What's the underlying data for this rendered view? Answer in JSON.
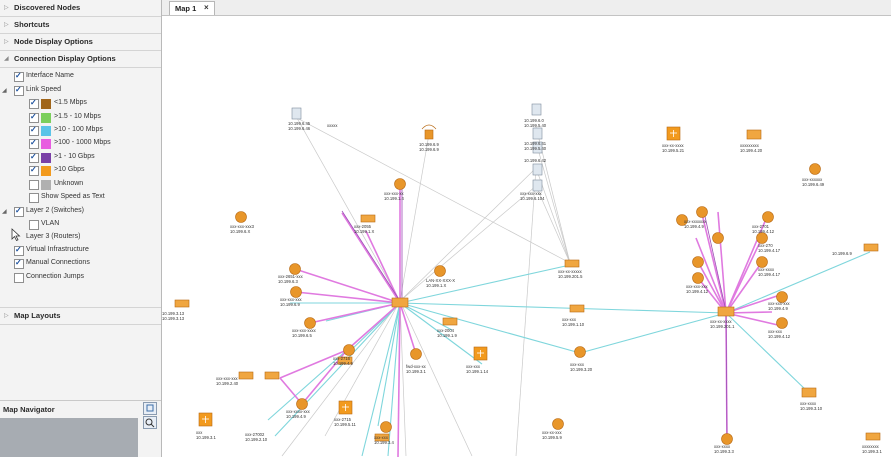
{
  "sidebar": {
    "sections": {
      "discovered": "Discovered Nodes",
      "shortcuts": "Shortcuts",
      "node_display": "Node Display Options",
      "connection_display": "Connection Display Options",
      "map_layouts": "Map Layouts"
    },
    "options": {
      "interface_name": "Interface Name",
      "link_speed": "Link Speed",
      "show_speed_text": "Show Speed as Text",
      "layer2": "Layer 2 (Switches)",
      "vlan": "VLAN",
      "layer3": "Layer 3 (Routers)",
      "virtual": "Virtual Infrastructure",
      "manual": "Manual Connections",
      "jumps": "Connection Jumps"
    },
    "speeds": [
      {
        "label": "<1.5 Mbps",
        "color": "#a0651a"
      },
      {
        "label": ">1.5 - 10 Mbps",
        "color": "#7bcf5c"
      },
      {
        "label": ">10 - 100 Mbps",
        "color": "#5bc4e8"
      },
      {
        "label": ">100 - 1000 Mbps",
        "color": "#e85ce0"
      },
      {
        "label": ">1 - 10 Gbps",
        "color": "#7a3fa6"
      },
      {
        "label": ">10 Gbps",
        "color": "#f29a1e"
      },
      {
        "label": "Unknown",
        "color": "#b0b0b0"
      }
    ],
    "map_navigator": "Map Navigator"
  },
  "tab": {
    "label": "Map 1",
    "close": "×"
  },
  "map": {
    "colors": {
      "router": "#e8962a",
      "cyan_link": "#7fd6dc",
      "pink_link": "#e07ae0"
    }
  }
}
